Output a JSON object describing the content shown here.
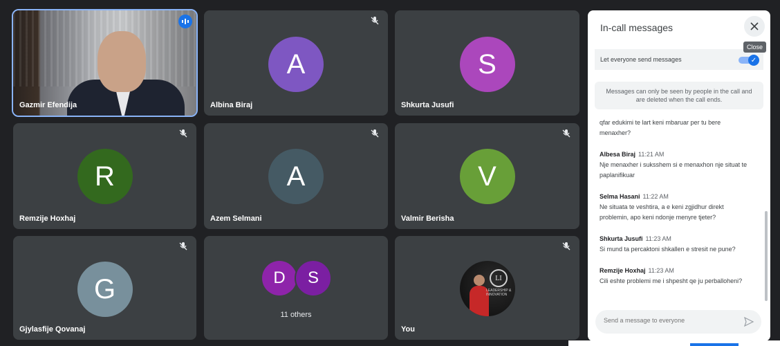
{
  "participants": [
    {
      "name": "Gazmir Efendija",
      "video": true,
      "speaking": true
    },
    {
      "name": "Albina Biraj",
      "initial": "A",
      "color": "#7e57c2",
      "muted": true
    },
    {
      "name": "Shkurta Jusufi",
      "initial": "S",
      "color": "#ab47bc",
      "muted": false
    },
    {
      "name": "Remzije Hoxhaj",
      "initial": "R",
      "color": "#33691e",
      "muted": true
    },
    {
      "name": "Azem Selmani",
      "initial": "A",
      "color": "#455a64",
      "muted": true
    },
    {
      "name": "Valmir Berisha",
      "initial": "V",
      "color": "#689f38",
      "muted": true
    },
    {
      "name": "Gjylasfije Qovanaj",
      "initial": "G",
      "color": "#78909c",
      "muted": true
    },
    {
      "name": "",
      "group": [
        "D",
        "S"
      ],
      "group_colors": [
        "#8e24aa",
        "#7b1fa2"
      ],
      "others_label": "11 others"
    },
    {
      "name": "You",
      "muted": true,
      "logo_text": "LEADERSHIP & INNOVATION"
    }
  ],
  "chat": {
    "title": "In-call messages",
    "close_tooltip": "Close",
    "toggle_label": "Let everyone send messages",
    "notice": "Messages can only be seen by people in the call and are deleted when the call ends.",
    "messages": [
      {
        "sender": "",
        "time": "",
        "text": "qfar edukimi te lart keni mbaruar per tu bere menaxher?"
      },
      {
        "sender": "Albesa Biraj",
        "time": "11:21 AM",
        "text": "Nje menaxher i suksshem si e menaxhon nje situat te paplanifikuar"
      },
      {
        "sender": "Selma Hasani",
        "time": "11:22 AM",
        "text": "Ne situata te veshtira, a e keni zgjidhur direkt problemin, apo keni ndonje menyre tjeter?"
      },
      {
        "sender": "Shkurta Jusufi",
        "time": "11:23 AM",
        "text": "Si mund ta percaktoni shkallen e stresit ne pune?"
      },
      {
        "sender": "Remzije Hoxhaj",
        "time": "11:23 AM",
        "text": "Cili eshte problemi me i shpesht qe ju perballoheni?"
      }
    ],
    "input_placeholder": "Send a message to everyone"
  }
}
